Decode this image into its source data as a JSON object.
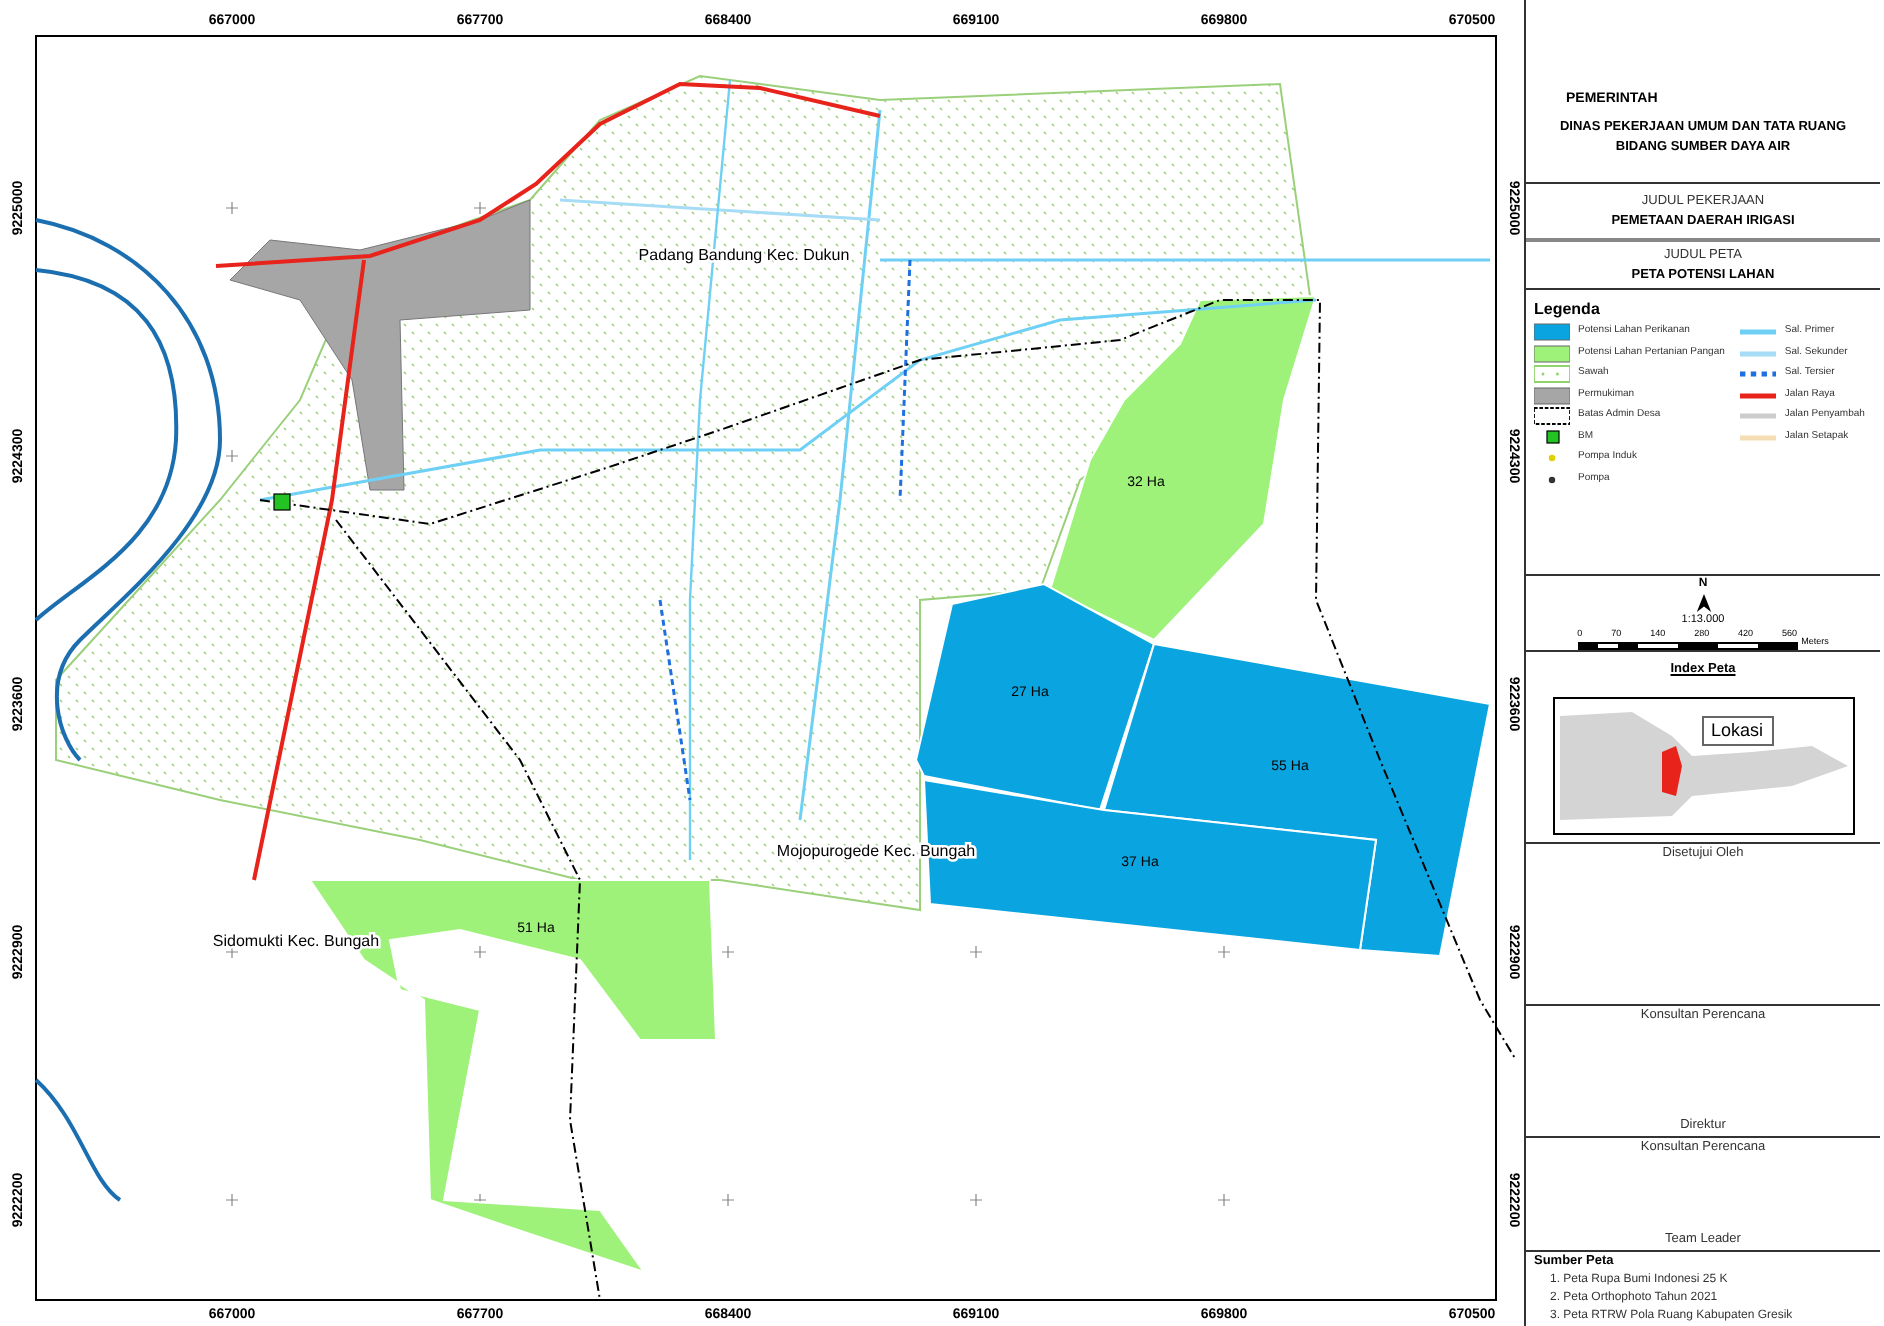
{
  "map": {
    "top_ticks": [
      "667000",
      "667700",
      "668400",
      "669100",
      "669800",
      "670500"
    ],
    "left_ticks": [
      "9225000",
      "9224300",
      "9223600",
      "9222900",
      "9222200"
    ],
    "right_ticks": [
      "9225000",
      "9224300",
      "9223600",
      "9222900",
      "9222200"
    ],
    "bottom_ticks": [
      "667000",
      "667700",
      "668400",
      "669100",
      "669800",
      "670500"
    ],
    "places": [
      {
        "label": "Padang Bandung Kec. Dukun"
      },
      {
        "label": "Mojopurogede Kec. Bungah"
      },
      {
        "label": "Sidomukti Kec. Bungah"
      }
    ],
    "areas": [
      {
        "label": "32 Ha",
        "kind": "farm"
      },
      {
        "label": "27 Ha",
        "kind": "fish"
      },
      {
        "label": "55 Ha",
        "kind": "fish"
      },
      {
        "label": "37 Ha",
        "kind": "fish"
      },
      {
        "label": "51 Ha",
        "kind": "farm"
      }
    ]
  },
  "title_block": {
    "agency": "PEMERINTAH",
    "department": "DINAS PEKERJAAN UMUM DAN TATA RUANG",
    "division": "BIDANG SUMBER DAYA AIR",
    "job_heading": "JUDUL PEKERJAAN",
    "job": "PEMETAAN DAERAH IRIGASI",
    "map_heading": "JUDUL PETA",
    "map_title": "PETA POTENSI LAHAN"
  },
  "legend": {
    "title": "Legenda",
    "left": [
      {
        "label": "Potensi Lahan Perikanan",
        "kind": "fill",
        "color": "#0aa5e0"
      },
      {
        "label": "Potensi Lahan Pertanian Pangan",
        "kind": "fill",
        "color": "#9ef27a"
      },
      {
        "label": "Sawah",
        "kind": "hatch",
        "color": "#8fd46a"
      },
      {
        "label": "Permukiman",
        "kind": "fill",
        "color": "#a6a6a6"
      },
      {
        "label": "Batas Admin Desa",
        "kind": "dashed",
        "color": "#000000"
      },
      {
        "label": "BM",
        "kind": "square",
        "color": "#22c322"
      },
      {
        "label": "Pompa Induk",
        "kind": "dot",
        "color": "#e0d000"
      },
      {
        "label": "Pompa",
        "kind": "dot",
        "color": "#333333"
      }
    ],
    "right": [
      {
        "label": "Sal. Primer",
        "kind": "line",
        "color": "#6fd0f5"
      },
      {
        "label": "Sal. Sekunder",
        "kind": "line",
        "color": "#a6dcf5"
      },
      {
        "label": "Sal. Tersier",
        "kind": "dots",
        "color": "#1e6fe0"
      },
      {
        "label": "Jalan Raya",
        "kind": "line",
        "color": "#e8231b"
      },
      {
        "label": "Jalan Penyambah",
        "kind": "line",
        "color": "#cccccc"
      },
      {
        "label": "Jalan Setapak",
        "kind": "line",
        "color": "#f5deb3"
      }
    ]
  },
  "scale": {
    "north": "N",
    "ratio": "1:13.000",
    "ticks": [
      "0",
      "70",
      "140",
      "280",
      "420",
      "560"
    ],
    "unit": "Meters"
  },
  "index_map": {
    "title": "Index Peta",
    "callout": "Lokasi"
  },
  "signatures": [
    {
      "label": "Disetujui Oleh"
    },
    {
      "label": "Konsultan Perencana"
    },
    {
      "label": "Direktur"
    },
    {
      "label": "Konsultan Perencana"
    },
    {
      "label": "Team Leader"
    }
  ],
  "sources": {
    "title": "Sumber Peta",
    "items": [
      "1. Peta Rupa Bumi Indonesi 25 K",
      "2. Peta Orthophoto Tahun 2021",
      "3. Peta RTRW Pola Ruang Kabupaten Gresik"
    ]
  }
}
